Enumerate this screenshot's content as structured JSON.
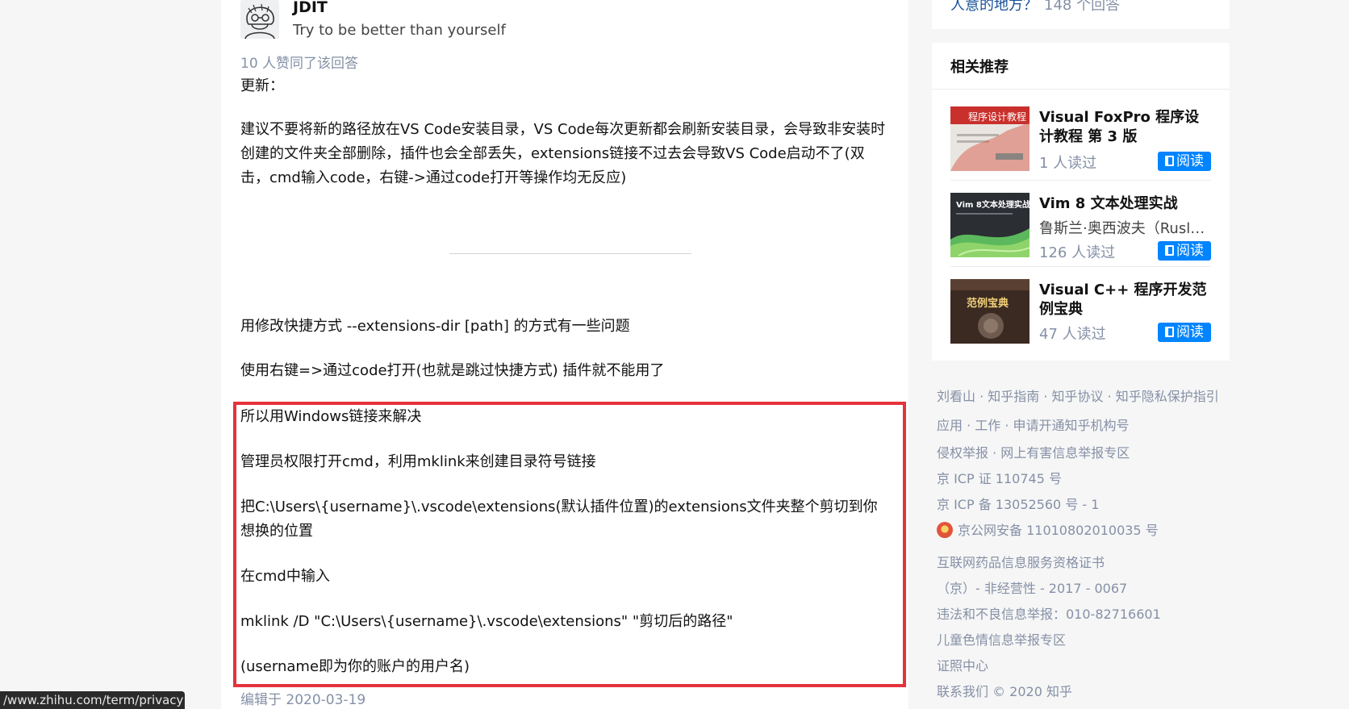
{
  "answer": {
    "author": {
      "name": "JDIT",
      "headline": "Try to be better than yourself"
    },
    "votes": "10 人赞同了该回答",
    "paragraphs": {
      "p1": "更新：",
      "p2": "建议不要将新的路径放在VS Code安装目录，VS Code每次更新都会刷新安装目录，会导致非安装时创建的文件夹全部删除，插件也会全部丢失，extensions链接不过去会导致VS Code启动不了(双击，cmd输入code，右键->通过code打开等操作均无反应)",
      "p3": "用修改快捷方式 --extensions-dir [path] 的方式有一些问题",
      "p4": "使用右键=>通过code打开(也就是跳过快捷方式) 插件就不能用了",
      "p5": "所以用Windows链接来解决",
      "p6": "管理员权限打开cmd，利用mklink来创建目录符号链接",
      "p7": "把C:\\Users\\{username}\\.vscode\\extensions(默认插件位置)的extensions文件夹整个剪切到你想换的位置",
      "p8": "在cmd中输入",
      "p9": "mklink /D \"C:\\Users\\{username}\\.vscode\\extensions\" \"剪切后的路径\"",
      "p10": "(username即为你的账户的用户名)"
    },
    "edited": "编辑于 2020-03-19"
  },
  "status_url": "/www.zhihu.com/term/privacy",
  "sidebar": {
    "top_question": {
      "text": "人意的地方？",
      "count": "148 个回答"
    },
    "recommend": {
      "title": "相关推荐",
      "read_label": "阅读",
      "books": [
        {
          "title": "Visual FoxPro 程序设计教程 第 3 版",
          "author": "",
          "reads": "1 人读过",
          "cover_text": "程序设计教程"
        },
        {
          "title": "Vim 8 文本处理实战",
          "author": "鲁斯兰·奥西波夫（Ruslan Osipov）",
          "reads": "126 人读过",
          "cover_text": "Vim 8文本处理实战"
        },
        {
          "title": "Visual C++ 程序开发范例宝典",
          "author": "",
          "reads": "47 人读过",
          "cover_text": "范例宝典"
        }
      ]
    }
  },
  "footer": {
    "line1": "刘看山 · 知乎指南 · 知乎协议 · 知乎隐私保护指引",
    "line2": "应用 · 工作 · 申请开通知乎机构号",
    "line3": "侵权举报 · 网上有害信息举报专区",
    "line4": "京 ICP 证 110745 号",
    "line5": "京 ICP 备 13052560 号 - 1",
    "line6": "京公网安备 11010802010035 号",
    "line7": "互联网药品信息服务资格证书",
    "line8": "（京）- 非经营性 - 2017 - 0067",
    "line9": "违法和不良信息举报：010-82716601",
    "line10": "儿童色情信息举报专区",
    "line11": "证照中心",
    "line12": "联系我们 © 2020 知乎"
  }
}
